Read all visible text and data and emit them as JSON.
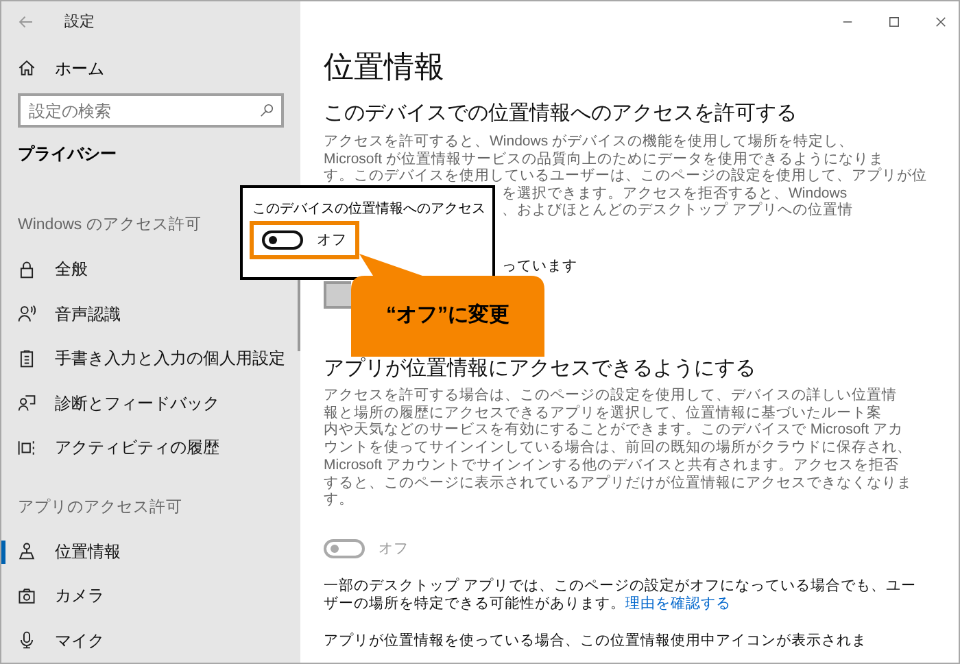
{
  "window": {
    "title": "設定"
  },
  "sidebar": {
    "home": "ホーム",
    "search": {
      "placeholder": "設定の検索"
    },
    "category": "プライバシー",
    "groups": [
      {
        "heading": "Windows のアクセス許可",
        "items": [
          {
            "label": "全般",
            "kind": "lock",
            "selected": false
          },
          {
            "label": "音声認識",
            "kind": "voice",
            "selected": false
          },
          {
            "label": "手書き入力と入力の個人用設定",
            "kind": "clipboard",
            "selected": false
          },
          {
            "label": "診断とフィードバック",
            "kind": "feedback",
            "selected": false
          },
          {
            "label": "アクティビティの履歴",
            "kind": "timeline",
            "selected": false
          }
        ]
      },
      {
        "heading": "アプリのアクセス許可",
        "items": [
          {
            "label": "位置情報",
            "kind": "location",
            "selected": true
          },
          {
            "label": "カメラ",
            "kind": "camera",
            "selected": false
          },
          {
            "label": "マイク",
            "kind": "mic",
            "selected": false
          }
        ]
      }
    ]
  },
  "main": {
    "title": "位置情報",
    "device_access": {
      "heading": "このデバイスでの位置情報へのアクセスを許可する",
      "lines": [
        "アクセスを許可すると、Windows がデバイスの機能を使用して場所を特定し、",
        "Microsoft が位置情報サービスの品質向上のためにデータを使用できるようになりま",
        "す。このデバイスを使用しているユーザーは、このページの設定を使用して、アプリが位"
      ],
      "visible_fragments": [
        "を選択できます。アクセスを拒否すると、Windows",
        "、およびほとんどのデスクトップ アプリへの位置情"
      ],
      "status_fragment": "っています"
    },
    "app_access": {
      "heading": "アプリが位置情報にアクセスできるようにする",
      "lines": [
        "アクセスを許可する場合は、このページの設定を使用して、デバイスの詳しい位置情",
        "報と場所の履歴にアクセスできるアプリを選択して、位置情報に基づいたルート案",
        "内や天気などのサービスを有効にすることができます。このデバイスで Microsoft アカ",
        "ウントを使ってサインインしている場合は、前回の既知の場所がクラウドに保存され、",
        "Microsoft アカウントでサインインする他のデバイスと共有されます。アクセスを拒否",
        "すると、このページに表示されているアプリだけが位置情報にアクセスできなくなりま",
        "す。"
      ],
      "toggle": {
        "on": false,
        "disabled": true,
        "label": "オフ"
      }
    },
    "note": {
      "lines": [
        "一部のデスクトップ アプリでは、このページの設定がオフになっている場合でも、ユー",
        "ザーの場所を特定できる可能性があります。"
      ],
      "link": "理由を確認する"
    },
    "icon_note": "アプリが位置情報を使っている場合、この位置情報使用中アイコンが表示されま"
  },
  "popup": {
    "label": "このデバイスの位置情報へのアクセス",
    "toggle": {
      "on": false,
      "highlighted": true,
      "label": "オフ"
    }
  },
  "callout": {
    "text": "“オフ”に変更"
  }
}
